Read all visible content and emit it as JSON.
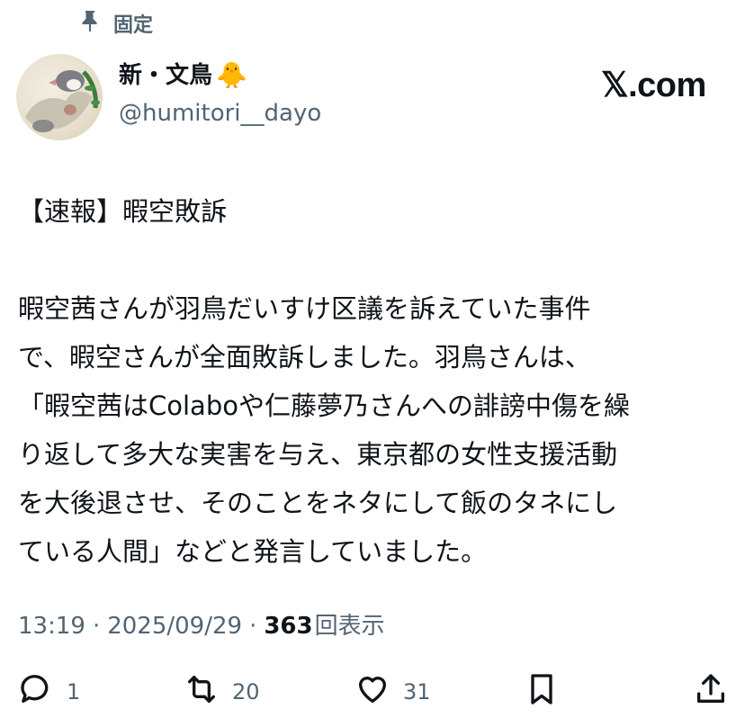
{
  "pinned": {
    "label": "固定",
    "icon": "pin-icon"
  },
  "author": {
    "name": "新・文鳥",
    "emoji": "🐥",
    "handle": "@humitori__dayo",
    "avatar": "bird-painting-avatar"
  },
  "brand": {
    "logo_text": "𝕏.com"
  },
  "tweet": {
    "text": "【速報】暇空敗訴\n\n暇空茜さんが羽鳥だいすけ区議を訴えていた事件\nで、暇空さんが全面敗訴しました。羽鳥さんは、\n「暇空茜はColaboや仁藤夢乃さんへの誹謗中傷を繰\nり返して多大な実害を与え、東京都の女性支援活動\nを大後退させ、そのことをネタにして飯のタネにし\nている人間」などと発言していました。"
  },
  "meta": {
    "time": "13:19",
    "sep1": "·",
    "date": "2025/09/29",
    "sep2": "·",
    "views_count": "363",
    "views_label": "回表示"
  },
  "actions": {
    "reply": {
      "count": "1",
      "icon": "reply-icon"
    },
    "retweet": {
      "count": "20",
      "icon": "retweet-icon"
    },
    "like": {
      "count": "31",
      "icon": "like-icon"
    },
    "bookmark": {
      "icon": "bookmark-icon"
    },
    "share": {
      "icon": "share-icon"
    }
  },
  "colors": {
    "text": "#0f1419",
    "secondary": "#536471"
  }
}
